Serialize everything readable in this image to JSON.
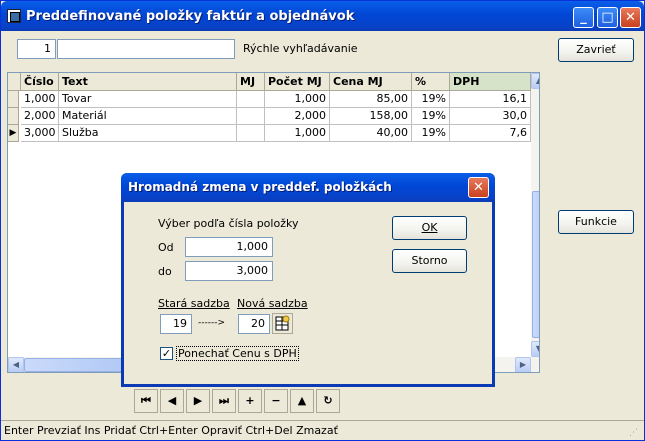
{
  "window": {
    "title": "Preddefinované položky faktúr a objednávok",
    "controls": {
      "minimize": "_",
      "maximize": "□",
      "close": "✕"
    }
  },
  "search": {
    "number": "1",
    "text": "",
    "label": "Rýchle vyhľadávanie"
  },
  "buttons": {
    "close": "Zavrieť",
    "functions": "Funkcie"
  },
  "table": {
    "columns": [
      "Číslo",
      "Text",
      "MJ",
      "Počet MJ",
      "Cena MJ",
      "%",
      "DPH"
    ],
    "rows": [
      {
        "cislo": "1,000",
        "text": "Tovar",
        "mj": "",
        "pocet": "1,000",
        "cena": "85,00",
        "pct": "19%",
        "dph": "16,1"
      },
      {
        "cislo": "2,000",
        "text": "Materiál",
        "mj": "",
        "pocet": "2,000",
        "cena": "158,00",
        "pct": "19%",
        "dph": "30,0"
      },
      {
        "cislo": "3,000",
        "text": "Služba",
        "mj": "",
        "pocet": "1,000",
        "cena": "40,00",
        "pct": "19%",
        "dph": "7,6"
      }
    ],
    "current_row_indicator": "▶"
  },
  "nav": {
    "first": "⏮",
    "prev": "◀",
    "next": "▶",
    "last": "⏭",
    "add": "+",
    "remove": "−",
    "up": "▲",
    "refresh": "↻"
  },
  "statusbar": {
    "text": "Enter Prevziať   Ins Pridať   Ctrl+Enter Opraviť   Ctrl+Del Zmazať"
  },
  "dialog": {
    "title": "Hromadná zmena v preddef. položkách",
    "section_label": "Výber podľa čísla položky",
    "from_label": "Od",
    "from_value": "1,000",
    "to_label": "do",
    "to_value": "3,000",
    "old_rate_label": "Stará sadzba",
    "old_rate_value": "19",
    "arrow": "------>",
    "new_rate_label": "Nová sadzba",
    "new_rate_value": "20",
    "checkbox_label": "Ponechať Cenu s DPH",
    "checkbox_checked": true,
    "ok": "OK",
    "cancel": "Storno",
    "close": "✕"
  },
  "colors": {
    "titlebar": "#0046D5",
    "face": "#ECE9D8",
    "dph_header": "#D7E3C8"
  }
}
